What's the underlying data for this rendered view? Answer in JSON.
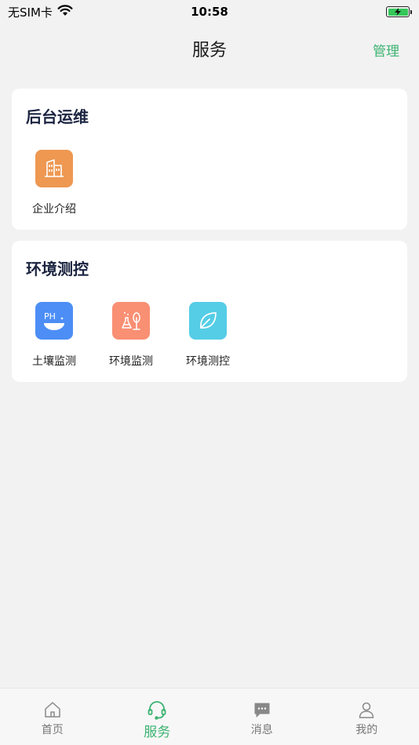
{
  "status_bar": {
    "carrier": "无SIM卡",
    "time": "10:58",
    "wifi_icon": "wifi-icon",
    "battery_icon": "battery-charging-icon"
  },
  "header": {
    "title": "服务",
    "action_label": "管理"
  },
  "sections": [
    {
      "title": "后台运维",
      "items": [
        {
          "label": "企业介绍",
          "icon": "building-icon",
          "color": "#ee9852"
        }
      ]
    },
    {
      "title": "环境测控",
      "items": [
        {
          "label": "土壤监测",
          "icon": "ph-soil-icon",
          "color": "#4c8ef5",
          "icon_text": "PH"
        },
        {
          "label": "环境监测",
          "icon": "environment-flask-icon",
          "color": "#f98f73"
        },
        {
          "label": "环境测控",
          "icon": "leaf-icon",
          "color": "#55cde6"
        }
      ]
    }
  ],
  "tab_bar": {
    "tabs": [
      {
        "label": "首页",
        "icon": "home-icon",
        "active": false
      },
      {
        "label": "服务",
        "icon": "headset-icon",
        "active": true
      },
      {
        "label": "消息",
        "icon": "message-icon",
        "active": false
      },
      {
        "label": "我的",
        "icon": "user-icon",
        "active": false
      }
    ]
  },
  "colors": {
    "accent": "#3cb371",
    "background": "#f2f2f2",
    "section_title": "#1b2440"
  }
}
